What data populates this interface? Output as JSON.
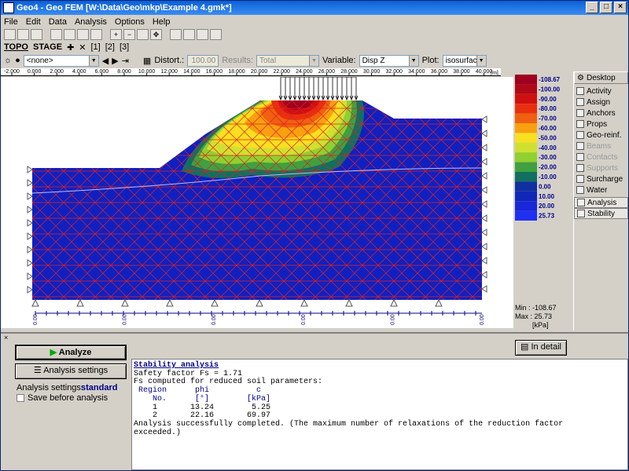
{
  "window": {
    "title": "Geo4 - Geo FEM [W:\\Data\\Geo\\mkp\\Example 4.gmk*]"
  },
  "menu": [
    "File",
    "Edit",
    "Data",
    "Analysis",
    "Options",
    "Help"
  ],
  "tabs": {
    "topo": "TOPO",
    "stage": "STAGE",
    "stages": [
      "[1]",
      "[2]",
      "[3]"
    ]
  },
  "stagebar": {
    "none_value": "<none>",
    "distort_label": "Distort.:",
    "distort_value": "100.00",
    "results_label": "Results:",
    "results_value": "Total",
    "variable_label": "Variable:",
    "variable_value": "Disp Z",
    "plot_label": "Plot:",
    "plot_value": "isosurface"
  },
  "ruler": {
    "ticks": [
      "-2.000",
      "0.000",
      "2.000",
      "4.000",
      "6.000",
      "8.000",
      "10.000",
      "12.000",
      "14.000",
      "16.000",
      "18.000",
      "20.000",
      "22.000",
      "24.000",
      "26.000",
      "28.000",
      "30.000",
      "32.000",
      "34.000",
      "36.000",
      "38.000",
      "40.000"
    ],
    "unit": "[m]"
  },
  "bottom_ruler": {
    "ticks": [
      "0.00",
      "0.00",
      "0.00",
      "0.00",
      "0.00",
      "0.00"
    ]
  },
  "legend": {
    "levels": [
      {
        "value": "-108.67",
        "color": "#a00020"
      },
      {
        "value": "-100.00",
        "color": "#b00818"
      },
      {
        "value": "-90.00",
        "color": "#d01010"
      },
      {
        "value": "-80.00",
        "color": "#e83010"
      },
      {
        "value": "-70.00",
        "color": "#f06010"
      },
      {
        "value": "-60.00",
        "color": "#f8a010"
      },
      {
        "value": "-50.00",
        "color": "#f8e020"
      },
      {
        "value": "-40.00",
        "color": "#d0e030"
      },
      {
        "value": "-30.00",
        "color": "#90d030"
      },
      {
        "value": "-20.00",
        "color": "#40a040"
      },
      {
        "value": "-10.00",
        "color": "#107060"
      },
      {
        "value": "0.00",
        "color": "#1030a0"
      },
      {
        "value": "10.00",
        "color": "#1028b8"
      },
      {
        "value": "20.00",
        "color": "#1828d8"
      },
      {
        "value": "25.73",
        "color": "#2030f0"
      }
    ],
    "min_label": "Min : -108.67",
    "max_label": "Max : 25.73",
    "unit": "[kPa]"
  },
  "sidebar": {
    "desktop": "Desktop",
    "items": [
      {
        "label": "Activity",
        "enabled": true
      },
      {
        "label": "Assign",
        "enabled": true
      },
      {
        "label": "Anchors",
        "enabled": true
      },
      {
        "label": "Props",
        "enabled": true
      },
      {
        "label": "Geo-reinf.",
        "enabled": true
      },
      {
        "label": "Beams",
        "enabled": false
      },
      {
        "label": "Contacts",
        "enabled": false
      },
      {
        "label": "Supports",
        "enabled": false
      },
      {
        "label": "Surcharge",
        "enabled": true
      },
      {
        "label": "Water",
        "enabled": true
      }
    ],
    "analysis": "Analysis",
    "stability": "Stability"
  },
  "panel": {
    "analyze": "Analyze",
    "analysis_settings_btn": "Analysis settings",
    "analysis_settings_label": "Analysis settings:",
    "analysis_settings_value": "standard",
    "save_before": "Save before analysis",
    "in_detail": "In detail"
  },
  "console": {
    "title": "Stability analysis",
    "line1": "Safety factor Fs = 1.71",
    "line2": "Fs computed for reduced soil parameters:",
    "hdr1": " Region      phi          c",
    "hdr2": "    No.      [°]        [kPa]",
    "row1": "    1       13.24        5.25",
    "row2": "    2       22.16       69.97",
    "line3": "Analysis successfully completed. (The maximum number of relaxations of the reduction factor",
    "line4": "exceeded.)"
  },
  "colors": {
    "accent": "#0a246a",
    "mesh": "#e02020",
    "soil": "#1020c0"
  }
}
